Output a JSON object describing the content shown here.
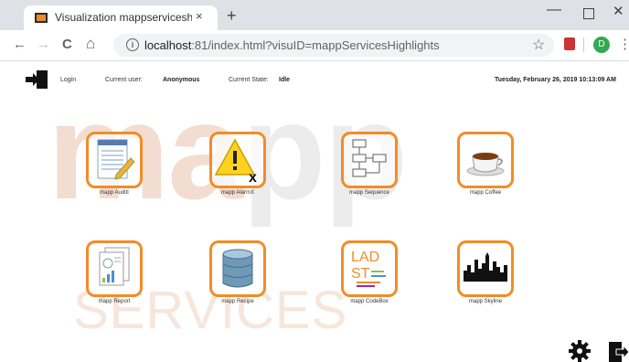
{
  "browser": {
    "tab_title": "Visualization mappserviceshighlig",
    "tab_close": "×",
    "new_tab": "+",
    "url_host": "localhost",
    "url_rest": ":81/index.html?visuID=mappServicesHighlights",
    "profile_initial": "D",
    "back": "←",
    "forward": "→",
    "reload": "C",
    "home": "⌂",
    "star": "☆",
    "kebab": "⋮",
    "min": "—",
    "close": "✕"
  },
  "appbar": {
    "login_label": "Login",
    "current_user_label": "Current user:",
    "current_user_value": "Anonymous",
    "current_state_label": "Current State:",
    "current_state_value": "Idle",
    "datetime": "Tuesday, February 26, 2019 10:13:09 AM"
  },
  "background": {
    "brand_word_part1": "ma",
    "brand_word_part2": "pp",
    "services_word": "SERVICES"
  },
  "tiles": [
    {
      "label": "mapp AuditI",
      "icon": "notepad-icon"
    },
    {
      "label": "mapp AlarmX",
      "icon": "warning-icon"
    },
    {
      "label": "mapp Sequence",
      "icon": "flowchart-icon"
    },
    {
      "label": "mapp Coffee",
      "icon": "coffee-cup-icon"
    },
    {
      "label": "mapp Report",
      "icon": "report-icon"
    },
    {
      "label": "mapp Recipe",
      "icon": "database-icon"
    },
    {
      "label": "mapp CodeBox",
      "icon": "codebox-icon"
    },
    {
      "label": "mapp Skyline",
      "icon": "skyline-icon"
    }
  ],
  "codebox_text": {
    "line1": "LAD",
    "line2": "ST"
  },
  "colors": {
    "accent": "#f28c28"
  }
}
